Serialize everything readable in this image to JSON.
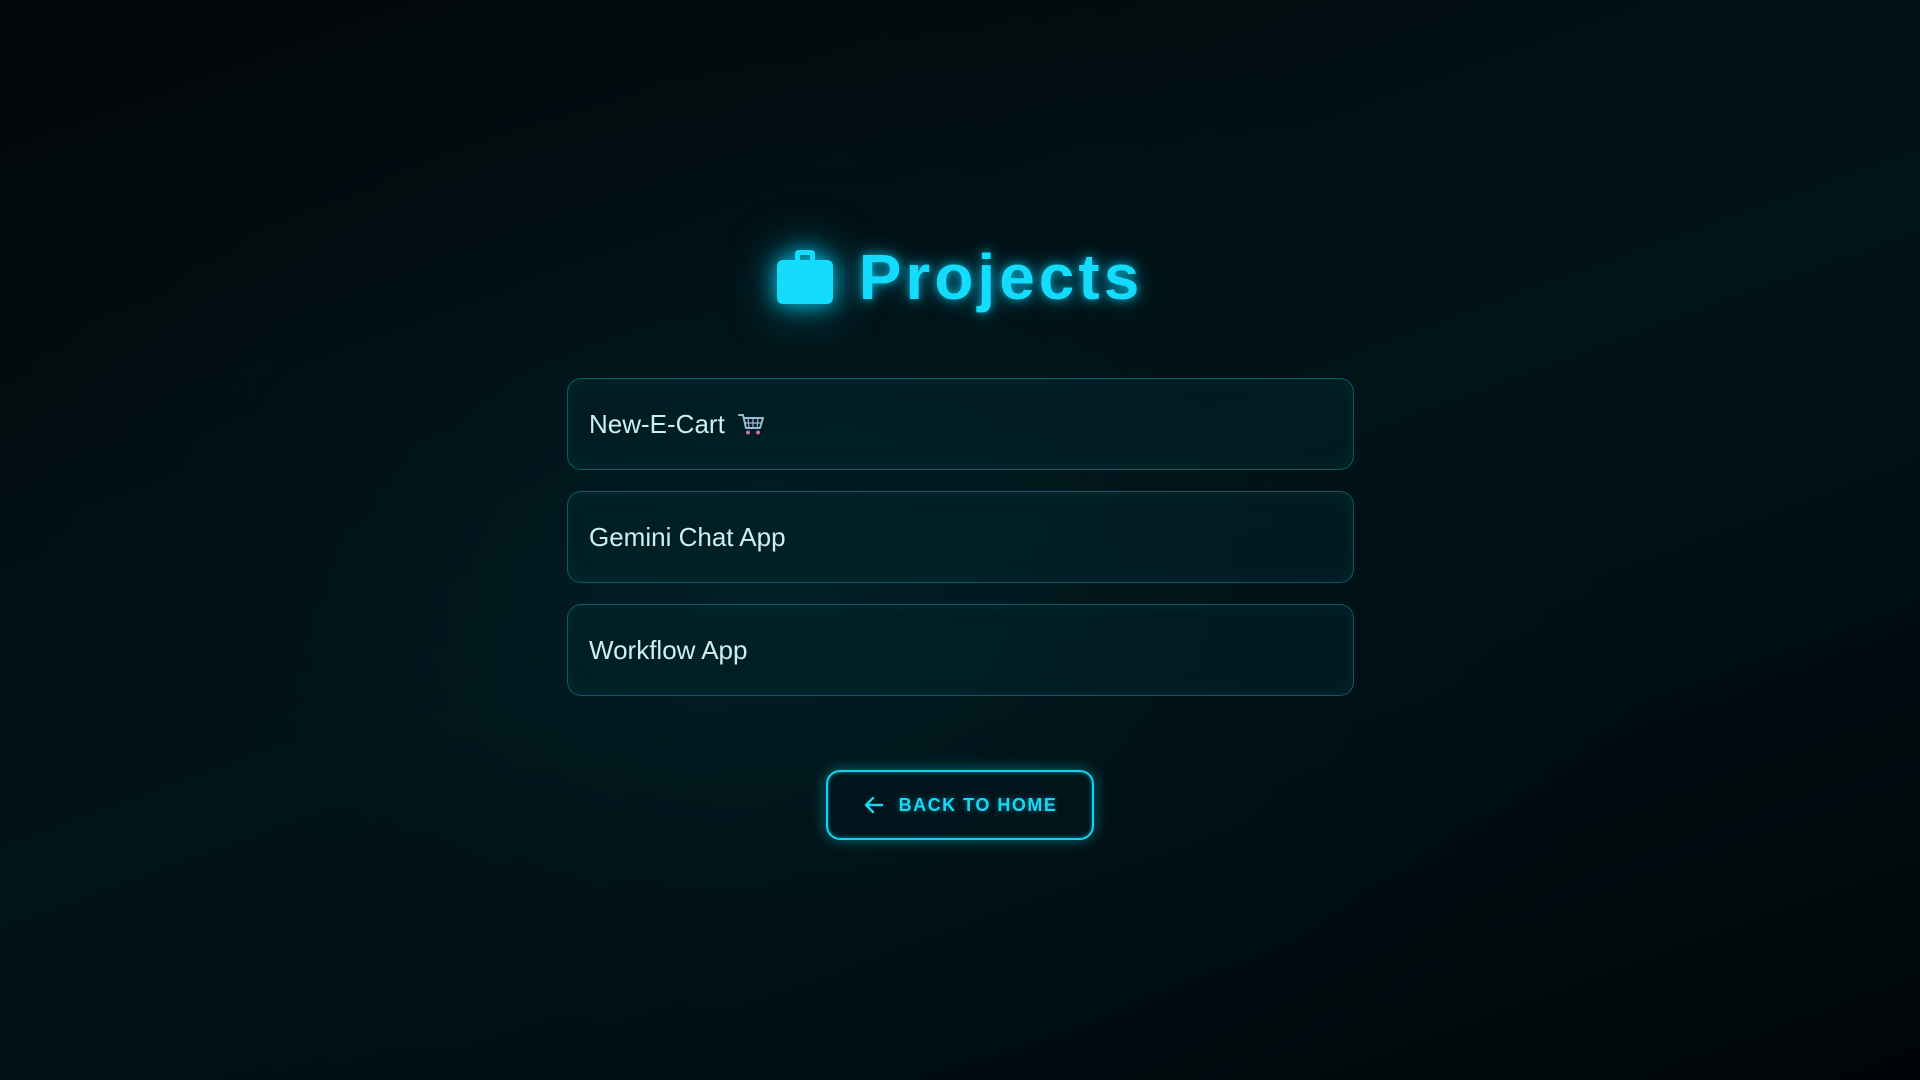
{
  "header": {
    "icon": "briefcase-icon",
    "title": "Projects"
  },
  "projects": [
    {
      "label": "New-E-Cart",
      "icon": "shopping-cart-icon"
    },
    {
      "label": "Gemini Chat App"
    },
    {
      "label": "Workflow App"
    }
  ],
  "back_button": {
    "icon": "arrow-left-icon",
    "label": "BACK TO HOME"
  },
  "colors": {
    "accent": "#14dcff",
    "card_border": "#188ca0",
    "background": "#011418",
    "text": "#cfeef3"
  }
}
